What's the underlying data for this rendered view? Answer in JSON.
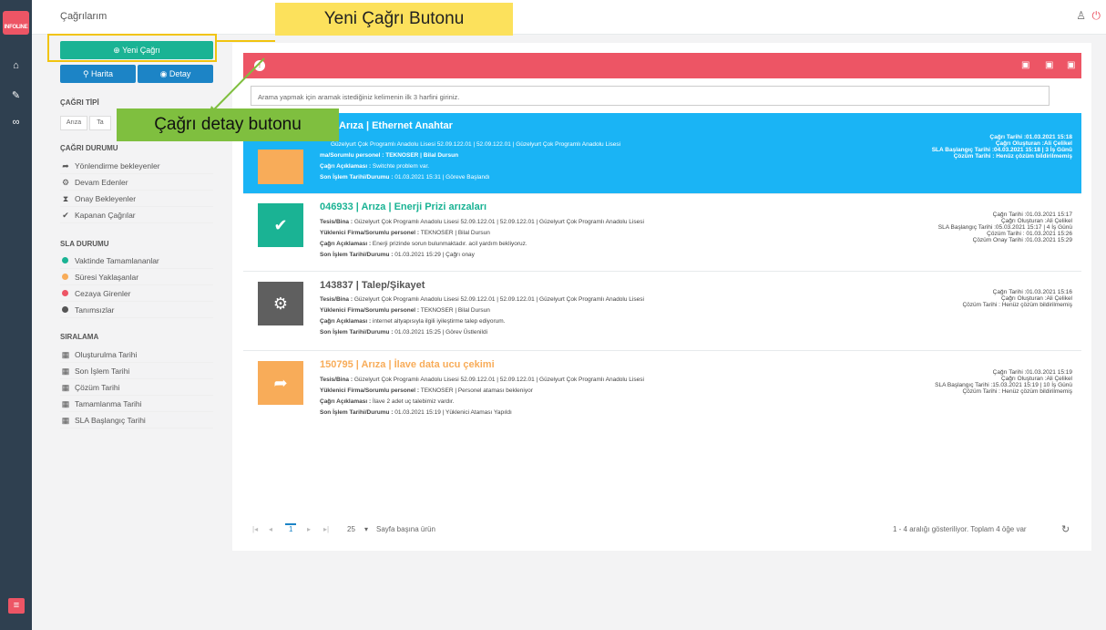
{
  "app": {
    "logo_text": "INFOLINE",
    "page_title": "Çağrılarım"
  },
  "rail": {
    "icons": [
      "home-icon",
      "wrench-icon",
      "link-icon"
    ],
    "menu_icon": "hamburger-icon"
  },
  "sidebar": {
    "new_call": "Yeni Çağrı",
    "map": "Harita",
    "detail": "Detay",
    "call_type_title": "ÇAĞRI TİPİ",
    "call_types": [
      "Arıza",
      "Ta"
    ],
    "call_status_title": "ÇAĞRI DURUMU",
    "call_status": [
      "Yönlendirme bekleyenler",
      "Devam Edenler",
      "Onay Bekleyenler",
      "Kapanan Çağrılar"
    ],
    "sla_title": "SLA DURUMU",
    "sla": [
      {
        "label": "Vaktinde Tamamlananlar",
        "color": "#1ab394"
      },
      {
        "label": "Süresi Yaklaşanlar",
        "color": "#f8ac59"
      },
      {
        "label": "Cezaya Girenler",
        "color": "#ed5565"
      },
      {
        "label": "Tanımsızlar",
        "color": "#555555"
      }
    ],
    "sort_title": "SIRALAMA",
    "sort": [
      "Oluşturulma Tarihi",
      "Son İşlem Tarihi",
      "Çözüm Tarihi",
      "Tamamlanma Tarihi",
      "SLA Başlangıç Tarihi"
    ]
  },
  "search": {
    "placeholder": "Arama yapmak için aramak istediğiniz kelimenin ilk 3 harfini giriniz."
  },
  "cards": [
    {
      "title": "Arıza | Ethernet Anahtar",
      "title_color": "#ffffff",
      "icon_color": "#f8ac59",
      "icon": "",
      "l1": "Güzelyurt Çok Programlı Anadolu Lisesi 52.09.122.01 | 52.09.122.01 | Güzelyurt Çok Programlı Anadolu Lisesi",
      "l2": "ma/Sorumlu personel : TEKNOSER | Bilal Dursun",
      "l3k": "Çağrı Açıklaması :",
      "l3v": " Switchte problem var.",
      "l4k": "Son İşlem Tarihi/Durumu :",
      "l4v": " 01.03.2021 15:31 | Göreve Başlandı",
      "r1": "Çağrı Tarihi :01.03.2021 15:18",
      "r2": "Çağrı Oluşturan :Ali Çelikel",
      "r3": "SLA Başlangıç Tarihi :04.03.2021 15:18 | 3 İş Günü",
      "r4": "Çözüm Tarihi : Henüz çözüm bildirilmemiş",
      "r5": ""
    },
    {
      "title": "046933 | Arıza | Enerji Prizi arızaları",
      "title_color": "#1ab394",
      "icon_color": "#1ab394",
      "icon": "✔",
      "l1k": "Tesis/Bina :",
      "l1": " Güzelyurt Çok Programlı Anadolu Lisesi 52.09.122.01 | 52.09.122.01 | Güzelyurt Çok Programlı Anadolu Lisesi",
      "l2k": "Yüklenici Firma/Sorumlu personel :",
      "l2": " TEKNOSER | Bilal Dursun",
      "l3k": "Çağrı Açıklaması :",
      "l3v": " Enerji prizinde sorun bulunmaktadır. acil yardım bekliyoruz.",
      "l4k": "Son İşlem Tarihi/Durumu :",
      "l4v": " 01.03.2021 15:29 | Çağrı onay",
      "r1": "Çağrı Tarihi :01.03.2021 15:17",
      "r2": "Çağrı Oluşturan :Ali Çelikel",
      "r3": "SLA Başlangıç Tarihi :05.03.2021 15:17 | 4 İş Günü",
      "r4": "Çözüm Tarihi : 01.03.2021 15:26",
      "r5": "Çözüm Onay Tarihi :01.03.2021 15:29"
    },
    {
      "title": "143837 | Talep/Şikayet",
      "title_color": "#555555",
      "icon_color": "#5f5f5f",
      "icon": "⚙",
      "l1k": "Tesis/Bina :",
      "l1": " Güzelyurt Çok Programlı Anadolu Lisesi 52.09.122.01 | 52.09.122.01 | Güzelyurt Çok Programlı Anadolu Lisesi",
      "l2k": "Yüklenici Firma/Sorumlu personel :",
      "l2": " TEKNOSER | Bilal Dursun",
      "l3k": "Çağrı Açıklaması :",
      "l3v": " internet altyapısıyla ilgili iyileştirme talep ediyorum.",
      "l4k": "Son İşlem Tarihi/Durumu :",
      "l4v": " 01.03.2021 15:25 | Görev Üstlenildi",
      "r1": "Çağrı Tarihi :01.03.2021 15:16",
      "r2": "Çağrı Oluşturan :Ali Çelikel",
      "r3": "Çözüm Tarihi : Henüz çözüm bildirilmemiş",
      "r4": "",
      "r5": ""
    },
    {
      "title": "150795 | Arıza | İlave data ucu çekimi",
      "title_color": "#f8ac59",
      "icon_color": "#f8ac59",
      "icon": "➦",
      "l1k": "Tesis/Bina :",
      "l1": " Güzelyurt Çok Programlı Anadolu Lisesi 52.09.122.01 | 52.09.122.01 | Güzelyurt Çok Programlı Anadolu Lisesi",
      "l2k": "Yüklenici Firma/Sorumlu personel :",
      "l2": " TEKNOSER | Personel ataması bekleniyor",
      "l3k": "Çağrı Açıklaması :",
      "l3v": " İlave 2 adet uç talebimiz vardır.",
      "l4k": "Son İşlem Tarihi/Durumu :",
      "l4v": " 01.03.2021 15:19 | Yüklenici Ataması Yapıldı",
      "r1": "Çağrı Tarihi :01.03.2021 15:19",
      "r2": "Çağrı Oluşturan :Ali Çelikel",
      "r3": "SLA Başlangıç Tarihi :15.03.2021 15:19 | 10 İş Günü",
      "r4": "Çözüm Tarihi : Henüz çözüm bildirilmemiş",
      "r5": ""
    }
  ],
  "pager": {
    "first": "|◂",
    "prev": "◂",
    "page": "1",
    "next": "▸",
    "last": "▸|",
    "size": "25",
    "size_label": "Sayfa başına ürün",
    "summary": "1 - 4 aralığı gösteriliyor. Toplam 4 öğe var"
  },
  "callouts": {
    "new_call": "Yeni Çağrı Butonu",
    "detail": "Çağrı detay butonu"
  }
}
